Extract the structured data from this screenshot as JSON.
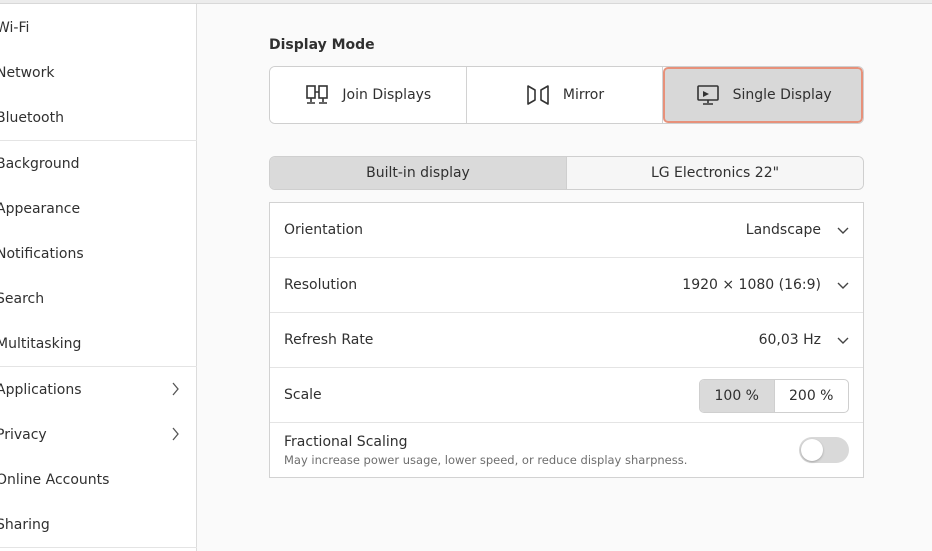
{
  "sidebar": {
    "items": [
      {
        "label": "Wi-Fi"
      },
      {
        "label": "Network"
      },
      {
        "label": "Bluetooth"
      },
      {
        "label": "Background"
      },
      {
        "label": "Appearance"
      },
      {
        "label": "Notifications"
      },
      {
        "label": "Search"
      },
      {
        "label": "Multitasking"
      },
      {
        "label": "Applications",
        "icon": "chevron-right-icon"
      },
      {
        "label": "Privacy",
        "icon": "chevron-right-icon"
      },
      {
        "label": "Online Accounts"
      },
      {
        "label": "Sharing"
      }
    ]
  },
  "display_mode": {
    "title": "Display Mode",
    "options": [
      {
        "label": "Join Displays",
        "icon": "join-displays-icon"
      },
      {
        "label": "Mirror",
        "icon": "mirror-icon"
      },
      {
        "label": "Single Display",
        "icon": "single-display-icon",
        "selected": true
      }
    ]
  },
  "displays": {
    "options": [
      {
        "label": "Built-in display",
        "selected": true
      },
      {
        "label": "LG Electronics 22\""
      }
    ]
  },
  "settings": {
    "orientation": {
      "label": "Orientation",
      "value": "Landscape"
    },
    "resolution": {
      "label": "Resolution",
      "value": "1920 × 1080 (16:9)"
    },
    "refresh_rate": {
      "label": "Refresh Rate",
      "value": "60,03 Hz"
    },
    "scale": {
      "label": "Scale",
      "options": [
        "100 %",
        "200 %"
      ],
      "selected": "100 %"
    },
    "fractional_scaling": {
      "label": "Fractional Scaling",
      "description": "May increase power usage, lower speed, or reduce display sharpness.",
      "enabled": false
    }
  },
  "colors": {
    "accent_border": "#e7917a",
    "selected_bg": "#d8d8d8"
  }
}
